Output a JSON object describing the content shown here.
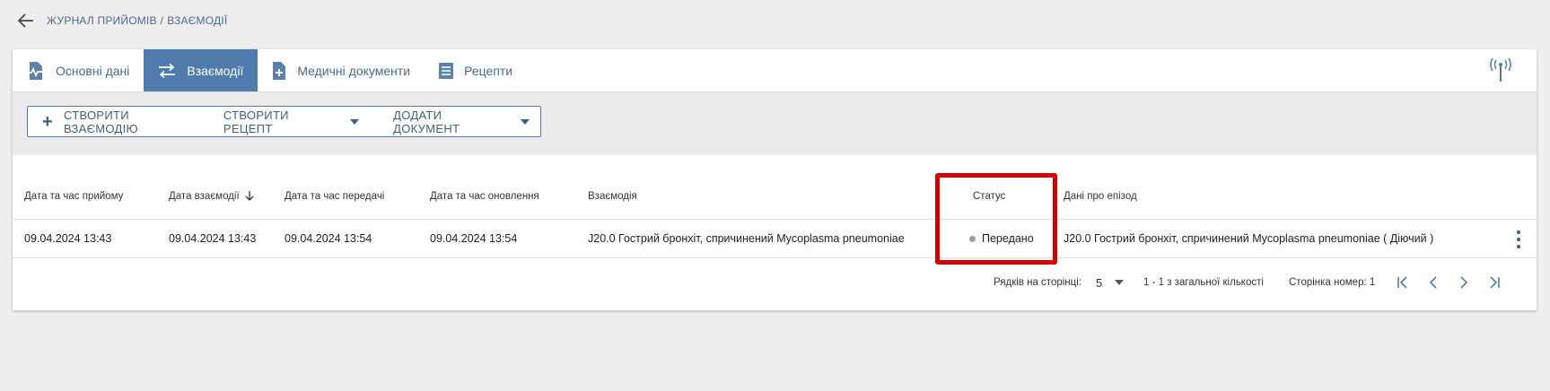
{
  "breadcrumb": {
    "parent": "ЖУРНАЛ ПРИЙОМІВ",
    "separator": "/",
    "current": "ВЗАЄМОДІЇ"
  },
  "tabs": [
    {
      "label": "Основні дані",
      "icon": "chart-document-icon",
      "active": false
    },
    {
      "label": "Взаємодії",
      "icon": "swap-arrows-icon",
      "active": true
    },
    {
      "label": "Медичні документи",
      "icon": "document-add-icon",
      "active": false
    },
    {
      "label": "Рецепти",
      "icon": "list-document-icon",
      "active": false
    }
  ],
  "actions": {
    "create_interaction": "СТВОРИТИ ВЗАЄМОДІЮ",
    "create_prescription": "СТВОРИТИ РЕЦЕПТ",
    "add_document": "ДОДАТИ ДОКУМЕНТ"
  },
  "table": {
    "headers": {
      "admission_datetime": "Дата та час прийому",
      "interaction_date": "Дата взаємодії",
      "transfer_datetime": "Дата та час передачі",
      "update_datetime": "Дата та час оновлення",
      "interaction": "Взаємодія",
      "status": "Статус",
      "episode": "Дані про епізод"
    },
    "rows": [
      {
        "admission_datetime": "09.04.2024 13:43",
        "interaction_date": "09.04.2024 13:43",
        "transfer_datetime": "09.04.2024 13:54",
        "update_datetime": "09.04.2024 13:54",
        "interaction": "J20.0 Гострий бронхіт, спричинений Mycoplasma pneumoniae",
        "status": "Передано",
        "episode": "J20.0 Гострий бронхіт, спричинений Mycoplasma pneumoniae ( Діючий )"
      }
    ]
  },
  "pagination": {
    "rows_per_page_label": "Рядків на сторінці:",
    "rows_per_page_value": "5",
    "range": "1 - 1 з загальної кількості",
    "page_label": "Сторінка номер: 1"
  },
  "colors": {
    "accent": "#4f7cad",
    "highlight": "#d40000",
    "status_dot": "#9e9e9e"
  }
}
